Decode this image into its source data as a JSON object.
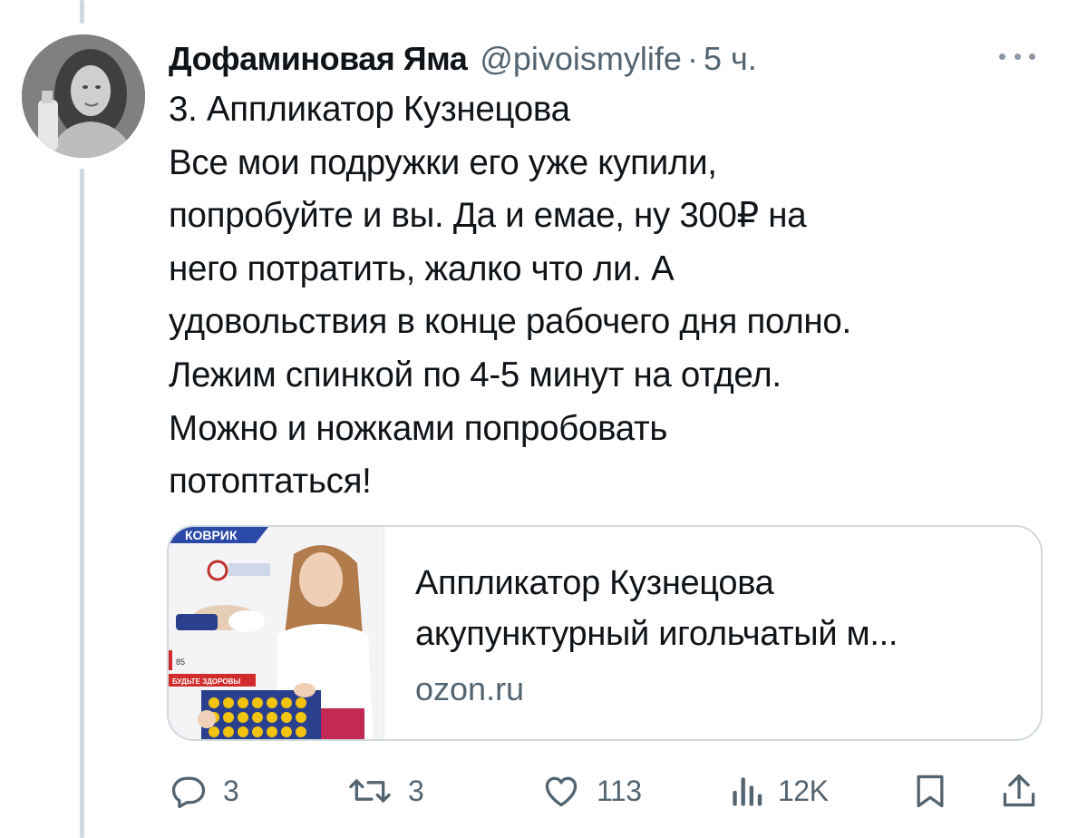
{
  "author": {
    "display_name": "Дофаминовая Яма",
    "handle": "@pivoismylife",
    "separator": "·",
    "timestamp": "5 ч."
  },
  "tweet": {
    "lines": [
      "3. Аппликатор Кузнецова",
      "Все мои подружки его уже купили,",
      "попробуйте и вы. Да и емае, ну 300₽ на",
      "него потратить, жалко что ли. А",
      "удовольствия в конце рабочего дня полно.",
      "Лежим спинкой по 4-5 минут на отдел.",
      "Можно и ножками попробовать",
      "потоптаться!"
    ]
  },
  "link_card": {
    "image_caption_top": "КОВРИК",
    "image_badge_count": "85",
    "image_badge_slogan": "БУДЬТЕ ЗДОРОВЫ",
    "title": "Аппликатор Кузнецова",
    "description": "акупунктурный игольчатый м...",
    "domain": "ozon.ru"
  },
  "actions": {
    "replies": "3",
    "reposts": "3",
    "likes": "113",
    "views": "12K"
  },
  "icons": {
    "reply": "reply-icon",
    "repost": "repost-icon",
    "like": "heart-icon",
    "views": "analytics-icon",
    "bookmark": "bookmark-icon",
    "share": "share-icon",
    "more": "more-icon"
  },
  "colors": {
    "text_primary": "#0f1419",
    "text_secondary": "#536471",
    "border": "#cfd9de",
    "mat_blue": "#2b3f8f",
    "mat_spikes": "#f2c40f"
  }
}
